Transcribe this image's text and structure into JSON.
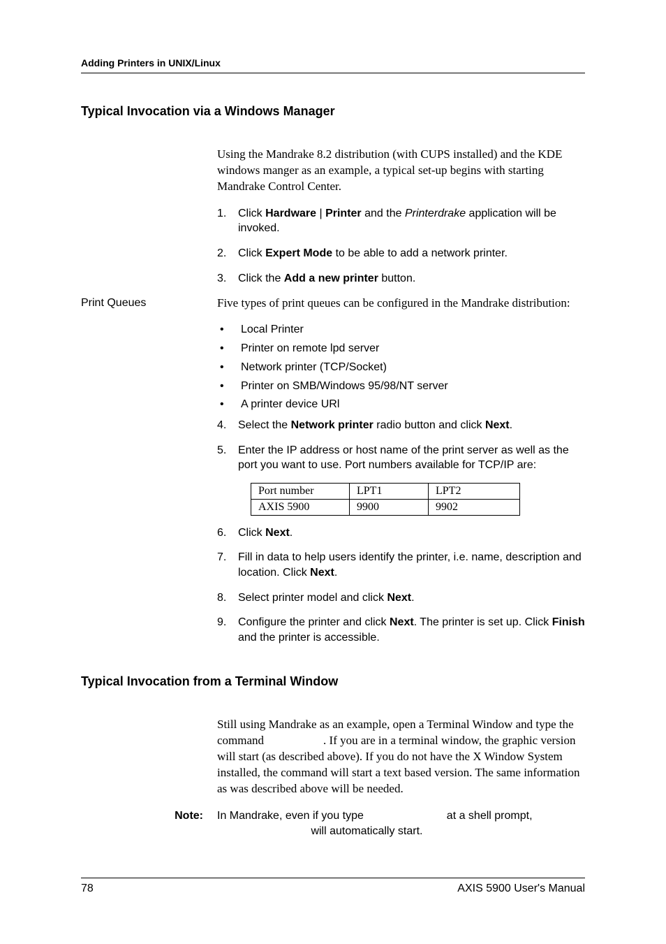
{
  "header": {
    "running_head": "Adding Printers in UNIX/Linux"
  },
  "section1": {
    "title": "Typical Invocation via a Windows Manager",
    "intro": "Using the Mandrake 8.2 distribution (with CUPS installed) and the KDE windows manger as an example, a typical set-up begins with starting Mandrake Control Center.",
    "step1": {
      "n": "1.",
      "a": "Click ",
      "b": "Hardware",
      "c": " | ",
      "d": "Printer",
      "e": " and the ",
      "f": "Printerdrake",
      "g": " application will be invoked."
    },
    "step2": {
      "n": "2.",
      "a": "Click ",
      "b": "Expert Mode",
      "c": " to be able to add a network printer."
    },
    "step3": {
      "n": "3.",
      "a": "Click the ",
      "b": "Add a new printer",
      "c": " button."
    }
  },
  "printqueues": {
    "side": "Print Queues",
    "intro": "Five types of print queues can be configured in the Mandrake distribution:",
    "bullets": [
      "Local Printer",
      "Printer on remote lpd server",
      "Network printer (TCP/Socket)",
      "Printer on SMB/Windows 95/98/NT server",
      "A printer device URl"
    ],
    "step4": {
      "n": "4.",
      "a": "Select the ",
      "b": "Network printer",
      "c": " radio button and click ",
      "d": "Next",
      "e": "."
    },
    "step5": {
      "n": "5.",
      "t": "Enter the IP address or host name of the print server as well as the port you want to use. Port numbers available for TCP/IP are:"
    },
    "table": {
      "r1c1": "Port number",
      "r1c2": "LPT1",
      "r1c3": "LPT2",
      "r2c1": "AXIS 5900",
      "r2c2": "9900",
      "r2c3": "9902"
    },
    "step6": {
      "n": "6.",
      "a": "Click ",
      "b": "Next",
      "c": "."
    },
    "step7": {
      "n": "7.",
      "a": "Fill in data to help users identify the printer, i.e. name, description and location. Click ",
      "b": "Next",
      "c": "."
    },
    "step8": {
      "n": "8.",
      "a": "Select printer model and click ",
      "b": "Next",
      "c": "."
    },
    "step9": {
      "n": "9.",
      "a": "Configure the printer and click ",
      "b": "Next",
      "c": ". The printer is set up. Click ",
      "d": "Finish",
      "e": " and the printer is accessible."
    }
  },
  "section2": {
    "title": "Typical Invocation from a Terminal Window",
    "para": "Still using Mandrake as an example, open a Terminal Window and type the command                    . If you are in a terminal window, the graphic version will start (as described above). If you do not have the X Window System installed, the command will start a text based version. The same information as was described above will be needed."
  },
  "note": {
    "side": "Note:",
    "a": "In Mandrake, even if you type ",
    "b": " at a shell prompt, ",
    "c": " will automatically start."
  },
  "footer": {
    "page": "78",
    "doc": "AXIS 5900 User's Manual"
  }
}
